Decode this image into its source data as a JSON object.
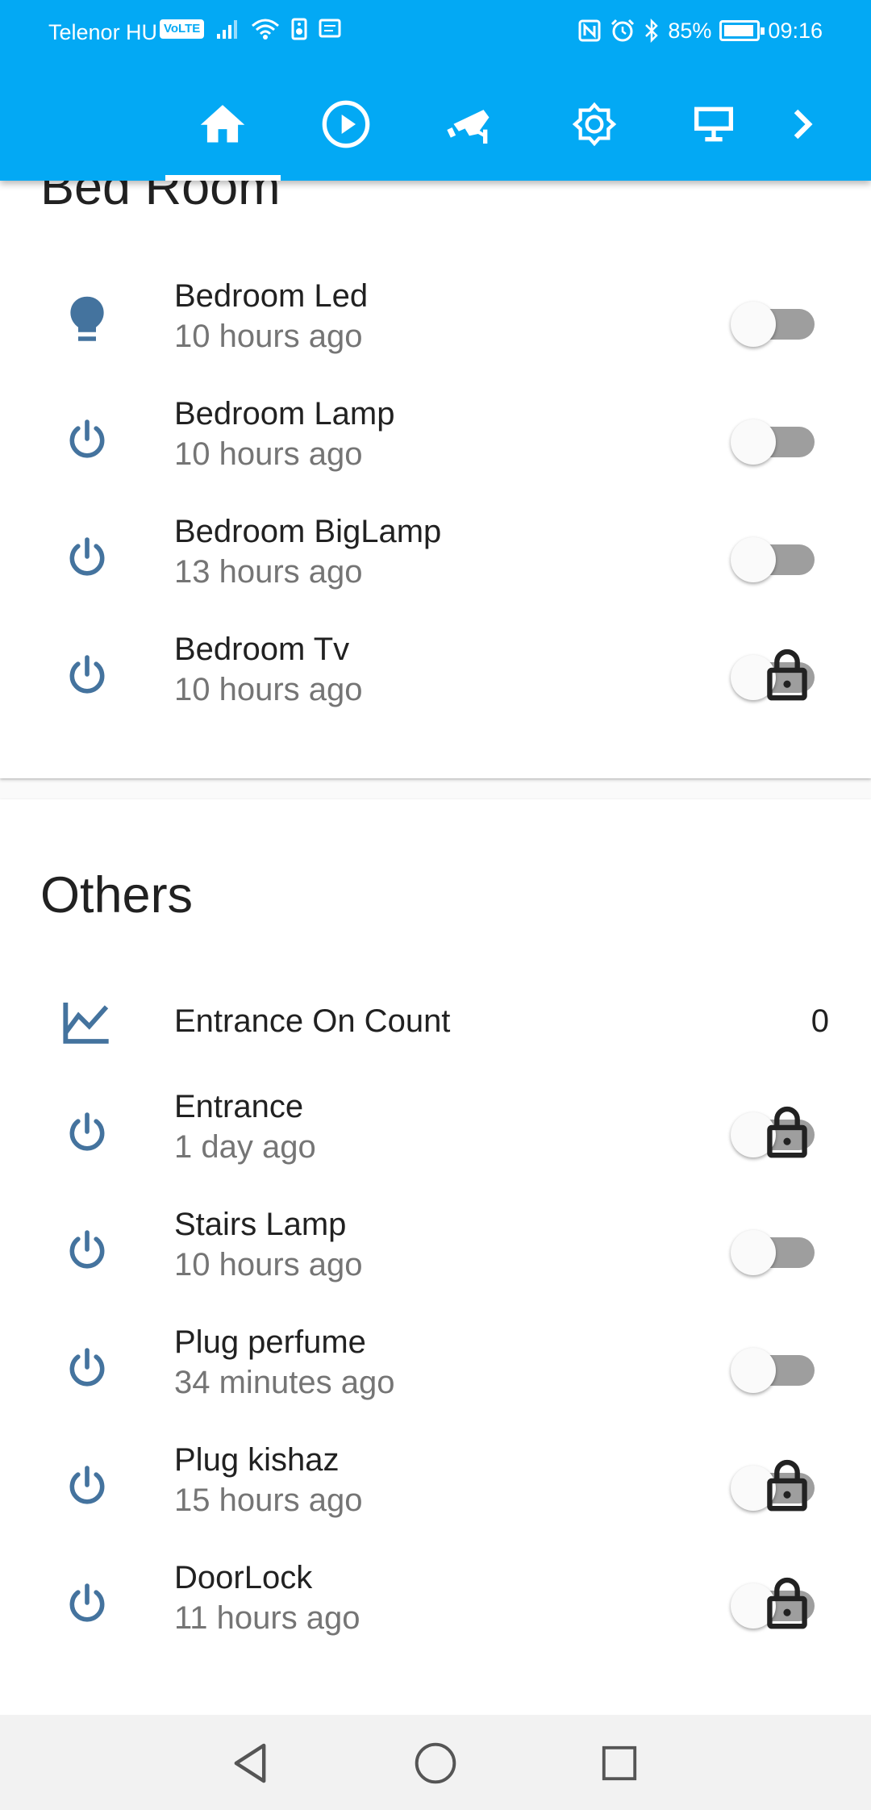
{
  "status_bar": {
    "carrier": "Telenor HU",
    "volte": "VoLTE",
    "battery_percent": "85%",
    "time": "09:16"
  },
  "tabs": [
    {
      "name": "home",
      "icon": "home-icon",
      "active": true
    },
    {
      "name": "media",
      "icon": "play-circle-icon",
      "active": false
    },
    {
      "name": "camera",
      "icon": "cctv-icon",
      "active": false
    },
    {
      "name": "brightness",
      "icon": "brightness-icon",
      "active": false
    },
    {
      "name": "desktop",
      "icon": "monitor-icon",
      "active": false
    },
    {
      "name": "more",
      "icon": "chevron-right-icon",
      "active": false
    }
  ],
  "bedroom_card": {
    "title": "Bed Room",
    "rows": [
      {
        "name": "Bedroom Led",
        "time": "10 hours ago",
        "icon": "bulb-icon",
        "state": "off",
        "locked": false
      },
      {
        "name": "Bedroom Lamp",
        "time": "10 hours ago",
        "icon": "power-icon",
        "state": "off",
        "locked": false
      },
      {
        "name": "Bedroom BigLamp",
        "time": "13 hours ago",
        "icon": "power-icon",
        "state": "off",
        "locked": false
      },
      {
        "name": "Bedroom Tv",
        "time": "10 hours ago",
        "icon": "power-icon",
        "state": "off",
        "locked": true
      }
    ]
  },
  "others_card": {
    "title": "Others",
    "counter": {
      "name": "Entrance On Count",
      "value": "0",
      "icon": "chart-line-icon"
    },
    "rows": [
      {
        "name": "Entrance",
        "time": "1 day ago",
        "icon": "power-icon",
        "state": "off",
        "locked": true
      },
      {
        "name": "Stairs Lamp",
        "time": "10 hours ago",
        "icon": "power-icon",
        "state": "off",
        "locked": false
      },
      {
        "name": "Plug perfume",
        "time": "34 minutes ago",
        "icon": "power-icon",
        "state": "off",
        "locked": false
      },
      {
        "name": "Plug kishaz",
        "time": "15 hours ago",
        "icon": "power-icon",
        "state": "off",
        "locked": true
      },
      {
        "name": "DoorLock",
        "time": "11 hours ago",
        "icon": "power-icon",
        "state": "off",
        "locked": true
      }
    ]
  },
  "colors": {
    "header": "#03a9f4",
    "icon": "#44739e",
    "track": "#9e9e9e"
  }
}
